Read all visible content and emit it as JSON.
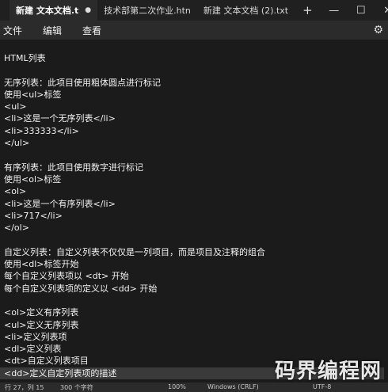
{
  "titlebar": {
    "tabs": [
      {
        "label": "新建 文本文档.t",
        "active": true,
        "modified_mark": "●"
      },
      {
        "label": "技术部第二次作业.htn",
        "active": false
      },
      {
        "label": "新建 文本文档 (2).txt",
        "active": false
      }
    ],
    "add_tab": "+",
    "minimize": "—",
    "maximize": "☐",
    "close": "✕"
  },
  "menu": {
    "items": [
      "文件",
      "编辑",
      "查看"
    ],
    "settings_icon": "⚙"
  },
  "editor": {
    "lines": [
      "HTML列表",
      "",
      "无序列表：此项目使用粗体圆点进行标记",
      "使用<ul>标签",
      "<ul>",
      "<li>这是一个无序列表</li>",
      "<li>333333</li>",
      "</ul>",
      "",
      "有序列表：此项目使用数字进行标记",
      "使用<ol>标签",
      "<ol>",
      "<li>这是一个有序列表</li>",
      "<li>717</li>",
      "</ol>",
      "",
      "自定义列表：自定义列表不仅仅是一列项目，而是项目及注释的组合",
      "使用<dl>标签开始",
      "每个自定义列表项以 <dt> 开始",
      "每个自定义列表项的定义以 <dd> 开始",
      "",
      "<ol>定义有序列表",
      "<ul>定义无序列表",
      "<li>定义列表项",
      "<dl>定义列表",
      "<dt>自定义列表项目",
      "<dd>定义自定列表项的描述"
    ],
    "highlighted_line": 26
  },
  "status": {
    "position": "行 27，列 15",
    "chars": "300 个字符",
    "zoom": "100%",
    "line_ending": "Windows (CRLF)",
    "encoding": "UTF-8"
  },
  "watermark": "码界编程网"
}
